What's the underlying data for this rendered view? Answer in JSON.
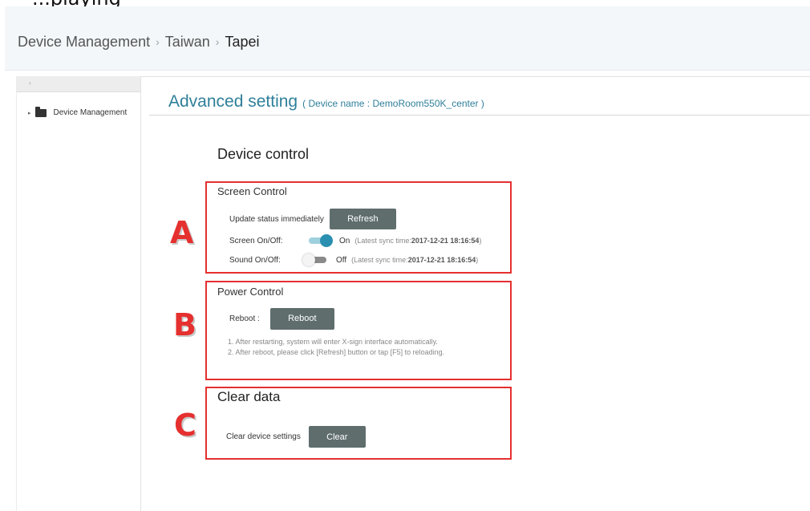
{
  "page": {
    "cut_title": "...playing"
  },
  "breadcrumb": {
    "items": [
      "Device Management",
      "Taiwan"
    ],
    "current": "Tapei",
    "separator": "›"
  },
  "sidebar": {
    "collapse_glyph": "‹",
    "tree": [
      {
        "label": "Device Management",
        "icon": "folder-icon",
        "caret": "▸"
      }
    ]
  },
  "header": {
    "title": "Advanced setting",
    "device_name": "( Device name : DemoRoom550K_center )"
  },
  "device_control": {
    "heading": "Device control"
  },
  "screen_control": {
    "title": "Screen Control",
    "update_label": "Update status immediately",
    "refresh_label": "Refresh",
    "screen_label": "Screen On/Off:",
    "screen_state": "On",
    "screen_on": true,
    "screen_sync_prefix": "(Latest sync time:",
    "screen_sync_time": "2017-12-21 18:16:54",
    "screen_sync_suffix": ")",
    "sound_label": "Sound On/Off:",
    "sound_state": "Off",
    "sound_on": false,
    "sound_sync_prefix": "(Latest sync time:",
    "sound_sync_time": "2017-12-21 18:16:54",
    "sound_sync_suffix": ")"
  },
  "power_control": {
    "title": "Power Control",
    "reboot_label": "Reboot :",
    "reboot_button": "Reboot",
    "notes": [
      "1. After restarting, system will enter X-sign interface automatically.",
      "2. After reboot, please click [Refresh] button or tap [F5] to reloading."
    ]
  },
  "clear_data": {
    "title": "Clear data",
    "label": "Clear device settings",
    "button": "Clear"
  },
  "markers": [
    "A",
    "B",
    "C"
  ],
  "colors": {
    "accent": "#2f7f9a",
    "toggle_on": "#2a8fb0",
    "button": "#5f6d6d",
    "annotation_red": "#e5302f"
  }
}
